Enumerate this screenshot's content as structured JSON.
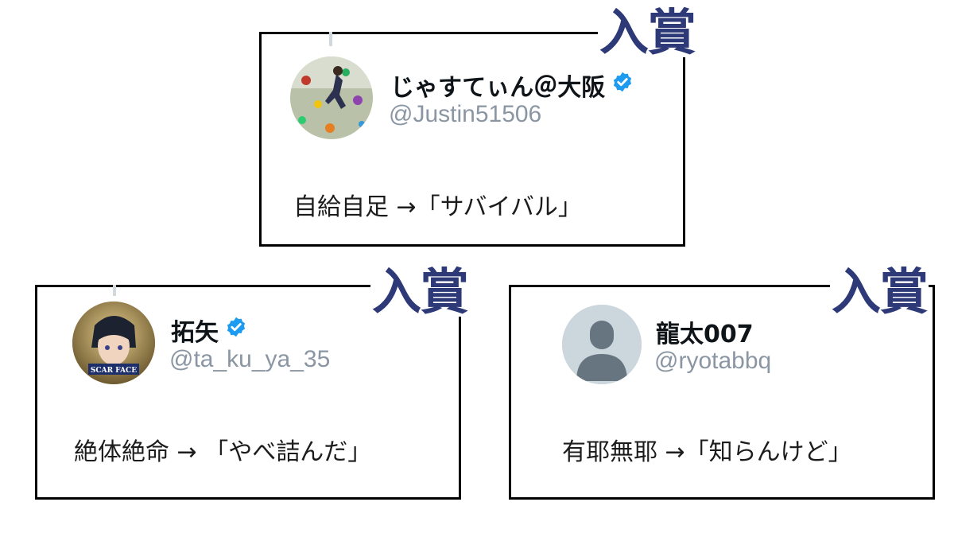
{
  "award_label": "入賞",
  "cards": [
    {
      "name": "じゃすてぃん＠大阪",
      "handle": "@Justin51506",
      "text": "自給自足 →「サバイバル」",
      "verified": true,
      "avatar": "climbing-photo"
    },
    {
      "name": "拓矢",
      "handle": "@ta_ku_ya_35",
      "text": "絶体絶命 → 「やべ詰んだ」",
      "verified": true,
      "avatar": "anime-scar-face"
    },
    {
      "name": "龍太007",
      "handle": "@ryotabbq",
      "text": "有耶無耶 →「知らんけど」",
      "verified": false,
      "avatar": "default-person"
    }
  ],
  "colors": {
    "award": "#2e3a78",
    "verified": "#1d9bf0",
    "handle": "#8a96a3",
    "border": "#000000"
  }
}
